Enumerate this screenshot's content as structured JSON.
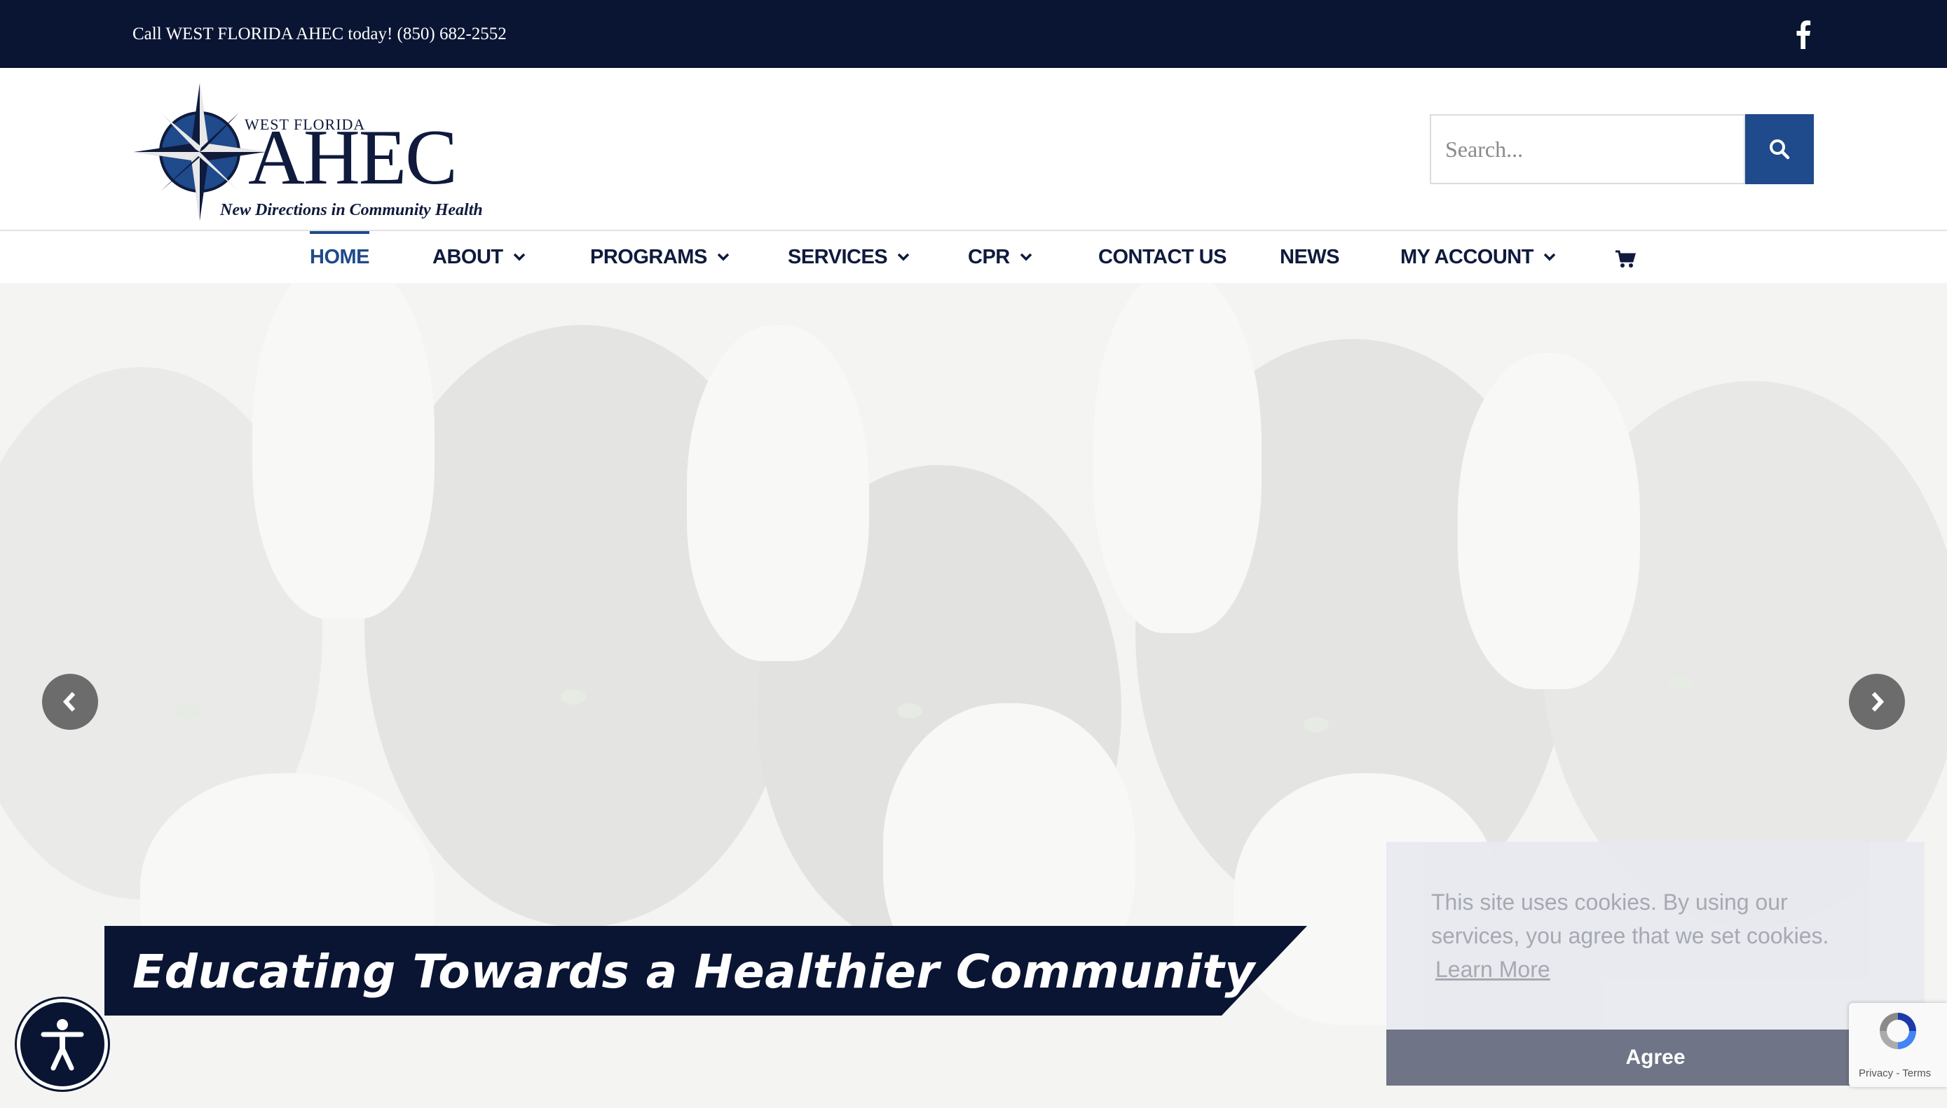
{
  "topbar": {
    "phone_text": "Call WEST FLORIDA AHEC today! (850) 682-2552",
    "social_icon": "facebook-icon"
  },
  "logo": {
    "org_region": "WEST FLORIDA",
    "org_name": "AHEC",
    "tagline": "New Directions in Community Health"
  },
  "search": {
    "placeholder": "Search...",
    "value": "",
    "button_icon": "search-icon"
  },
  "nav": {
    "items": [
      {
        "label": "HOME",
        "active": true,
        "dropdown": false
      },
      {
        "label": "ABOUT",
        "active": false,
        "dropdown": true
      },
      {
        "label": "PROGRAMS",
        "active": false,
        "dropdown": true
      },
      {
        "label": "SERVICES",
        "active": false,
        "dropdown": true
      },
      {
        "label": "CPR",
        "active": false,
        "dropdown": true
      },
      {
        "label": "CONTACT US",
        "active": false,
        "dropdown": false
      },
      {
        "label": "NEWS",
        "active": false,
        "dropdown": false
      },
      {
        "label": "MY ACCOUNT",
        "active": false,
        "dropdown": true
      }
    ],
    "cart_icon": "shopping-cart-icon"
  },
  "hero": {
    "caption": "Educating Towards a Healthier Community",
    "prev_icon": "chevron-left-icon",
    "next_icon": "chevron-right-icon"
  },
  "cookie_notice": {
    "text": "This site uses cookies. By using our services, you agree that we set cookies.",
    "link_label": "Learn More",
    "agree_label": "Agree"
  },
  "accessibility": {
    "icon": "accessibility-icon"
  },
  "recaptcha": {
    "text": "Privacy - Terms"
  },
  "colors": {
    "navy": "#0a1533",
    "brand_blue": "#1f4a8b",
    "cookie_bg": "#e8eaf0",
    "cookie_button": "#6f7587"
  }
}
